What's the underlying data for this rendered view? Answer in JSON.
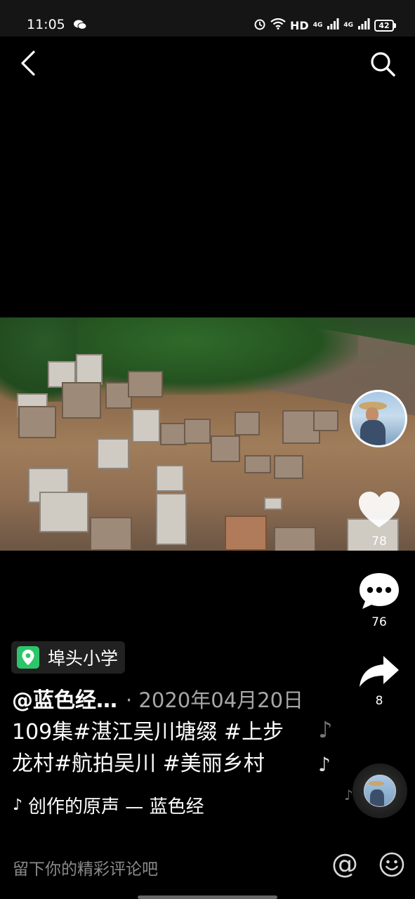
{
  "status_bar": {
    "time": "11:05",
    "hd": "HD",
    "net1": "4G",
    "net2": "4G",
    "battery": "42",
    "icons": [
      "wechat-icon",
      "alarm-icon",
      "wifi-icon",
      "signal-icon",
      "signal-icon",
      "battery-icon"
    ]
  },
  "nav": {
    "back_icon": "chevron-left-icon",
    "search_icon": "search-icon"
  },
  "sidebar": {
    "like_count": "78",
    "comment_count": "76",
    "share_count": "8"
  },
  "post": {
    "location": "埠头小学",
    "author": "@蓝色经…",
    "date": "· 2020年04月20日",
    "caption_line1": "109集#湛江吴川塘缀 #上步",
    "caption_line2": "龙村#航拍吴川 #美丽乡村",
    "music": "创作的原声 — 蓝色经"
  },
  "comment_bar": {
    "placeholder": "留下你的精彩评论吧",
    "at_symbol": "@"
  },
  "colors": {
    "background": "#000000",
    "location_pin": "#2dc56a",
    "secondary_text": "#a7a7a7"
  }
}
